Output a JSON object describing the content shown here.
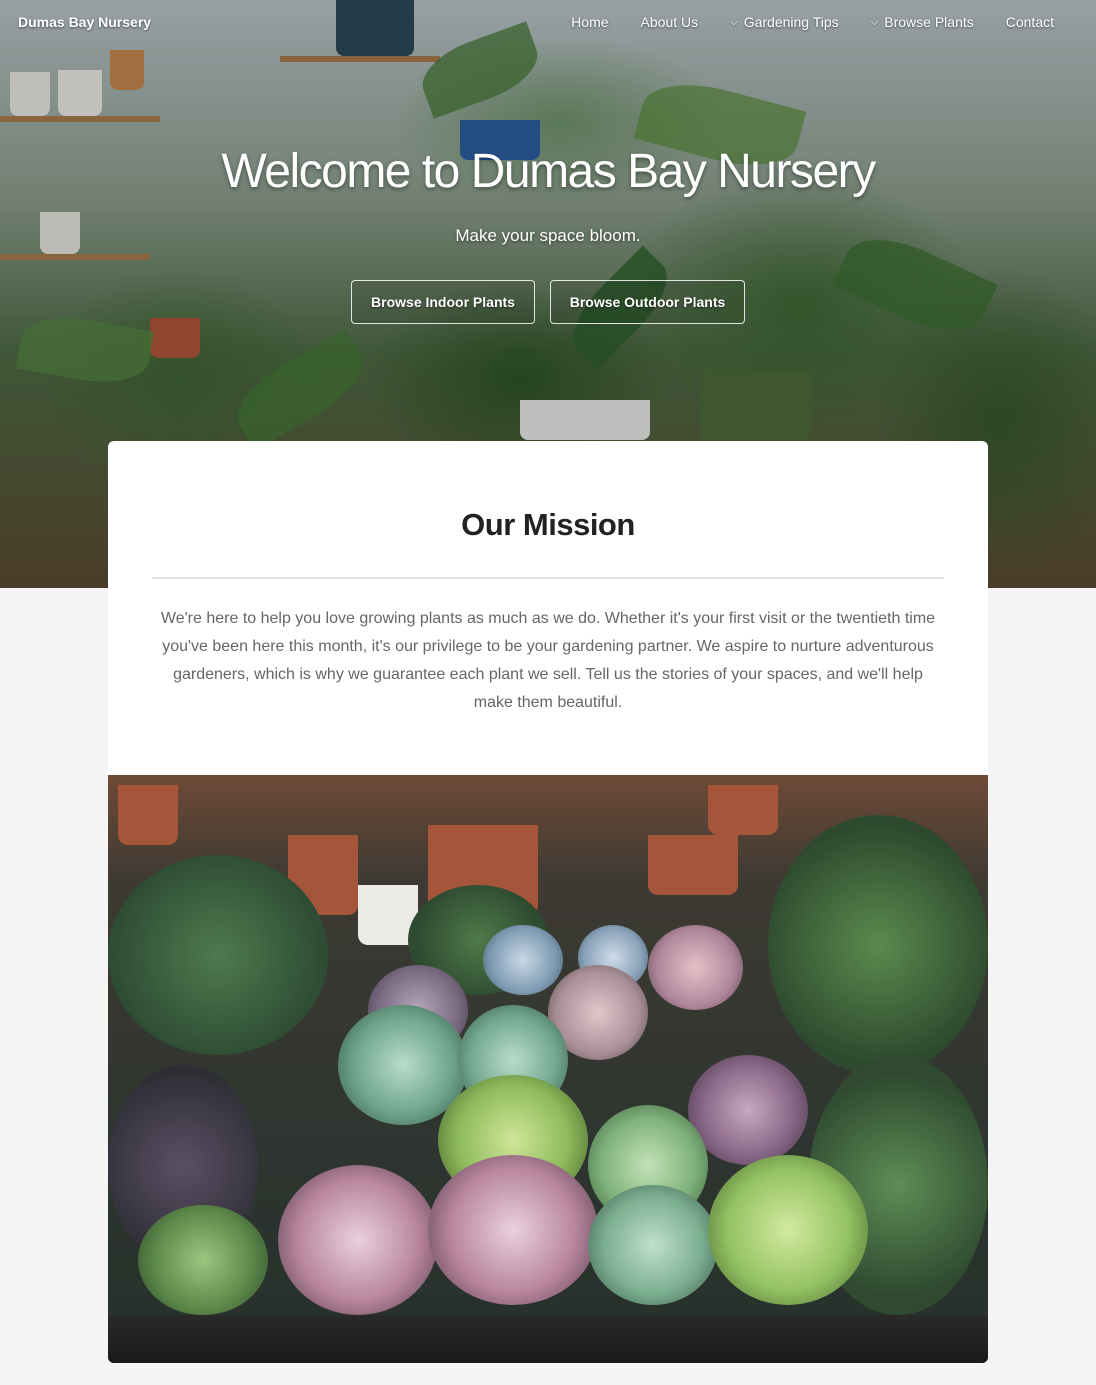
{
  "brand": "Dumas Bay Nursery",
  "nav": {
    "home": "Home",
    "about": "About Us",
    "tips": "Gardening Tips",
    "browse": "Browse Plants",
    "contact": "Contact",
    "dropdown_icon": "chevron-down-icon"
  },
  "hero": {
    "title": "Welcome to Dumas Bay Nursery",
    "subtitle": "Make your space bloom.",
    "btn_indoor": "Browse Indoor Plants",
    "btn_outdoor": "Browse Outdoor Plants"
  },
  "mission": {
    "title": "Our Mission",
    "text": "We're here to help you love growing plants as much as we do. Whether it's your first visit or the twentieth time you've been here this month, it's our privilege to be your gardening partner. We aspire to nurture adventurous gardeners, which is why we guarantee each plant we sell. Tell us the stories of your spaces, and we'll help make them beautiful."
  },
  "colors": {
    "background": "#f4f4f4",
    "card": "#ffffff",
    "title_text": "#222222",
    "body_text": "#666666"
  }
}
